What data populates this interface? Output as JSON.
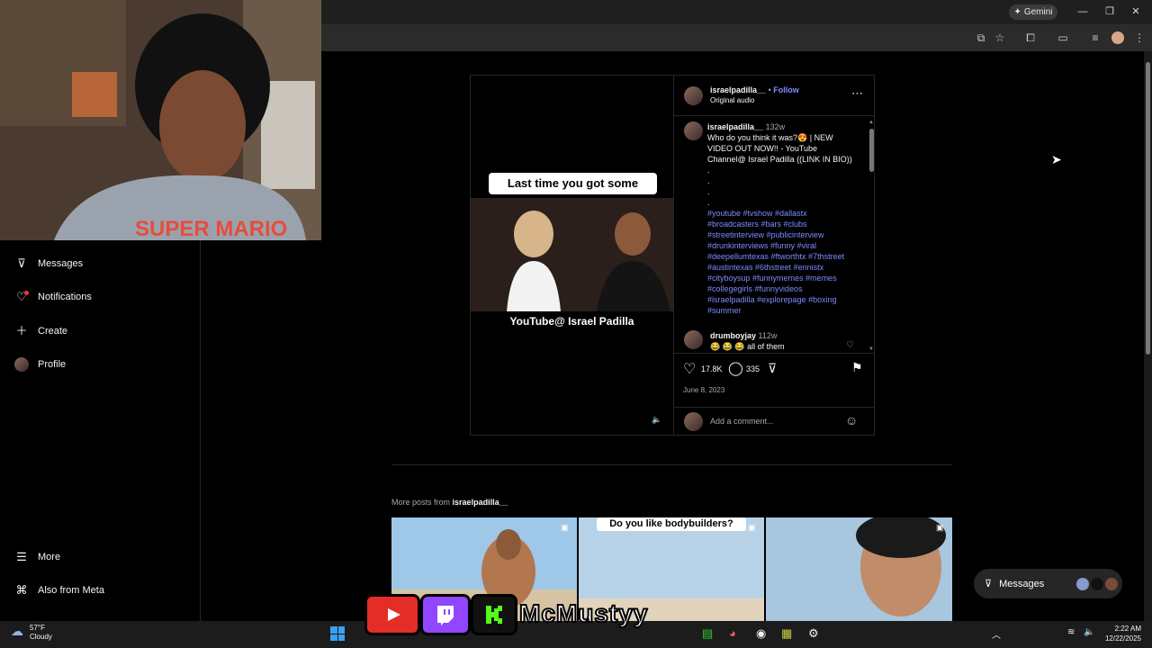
{
  "browser": {
    "gemini_label": "Gemini",
    "toolbar_icons": [
      "install-icon",
      "star-icon",
      "extensions-icon",
      "side-panel-icon",
      "media-icon",
      "profile-avatar",
      "menu-dots-icon"
    ]
  },
  "sidebar": {
    "items": [
      {
        "label": "Messages",
        "icon": "paper-plane-icon"
      },
      {
        "label": "Notifications",
        "icon": "heart-icon"
      },
      {
        "label": "Create",
        "icon": "plus-icon"
      },
      {
        "label": "Profile",
        "icon": "avatar"
      }
    ],
    "bottom": [
      {
        "label": "More",
        "icon": "hamburger-icon"
      },
      {
        "label": "Also from Meta",
        "icon": "meta-grid-icon"
      }
    ]
  },
  "post": {
    "username": "israelpadilla__",
    "follow": "Follow",
    "separator": "•",
    "audio": "Original audio",
    "video_caption_top": "Last time you got some",
    "video_caption_bottom": "YouTube@ Israel Padilla",
    "caption": {
      "user": "israelpadilla__",
      "age": "132w",
      "text1": "Who do you think it was?😍 | NEW",
      "text2": "VIDEO OUT NOW!! - YouTube",
      "text3": "Channel@ Israel Padilla ((LINK IN BIO))",
      "dots": ".",
      "hashtags": [
        "#youtube #tvshow #dallastx",
        "#broadcasters #bars #clubs",
        "#streetinterview #publicinterview",
        "#drunkinterviews #funny #viral",
        "#deepellumtexas #ftworthtx #7thstreet",
        "#austintexas #6thstreet #ennistx",
        "#cityboysup #funnymemes #memes",
        "#collegegirls #funnyvideos",
        "#israelpadilla #explorepage #boxing",
        "#summer"
      ]
    },
    "comment": {
      "user": "drumboyjay",
      "age": "112w",
      "text": "😂 😂 😂 all of them"
    },
    "likes": "17.8K",
    "comments_count": "335",
    "date": "June 8, 2023",
    "add_comment_placeholder": "Add a comment..."
  },
  "more_posts": {
    "label": "More posts from",
    "user": "israelpadilla__",
    "thumb2_caption": "Do you like bodybuilders?"
  },
  "messages_pill": {
    "label": "Messages"
  },
  "overlay": {
    "name": "McMustyy"
  },
  "taskbar": {
    "weather_temp": "57°F",
    "weather_desc": "Cloudy",
    "time": "2:22 AM",
    "date": "12/22/2025"
  }
}
